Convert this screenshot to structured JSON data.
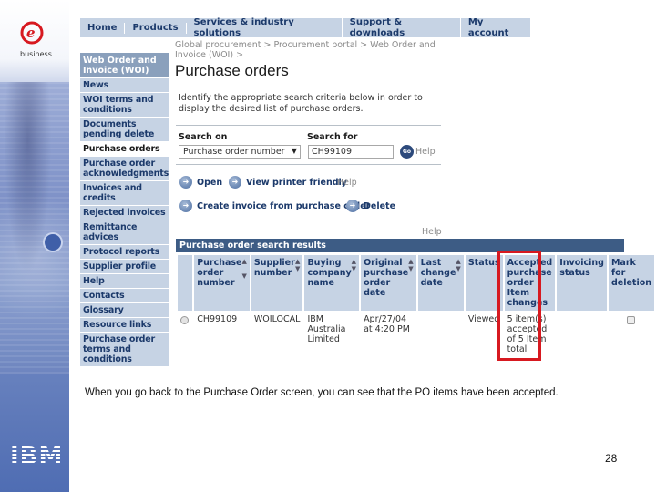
{
  "slide": {
    "caption": "When you go back to the Purchase Order screen, you can see that the PO items have been accepted.",
    "page_number": "28",
    "logo_top": {
      "icon": "e-business-logo",
      "text": "business"
    },
    "logo_bottom": {
      "icon": "ibm-logo",
      "text": "IBM"
    }
  },
  "topnav": {
    "items": [
      "Home",
      "Products",
      "Services & industry solutions",
      "Support & downloads",
      "My account"
    ]
  },
  "sidenav": {
    "header": "Web Order and Invoice (WOI)",
    "items": [
      {
        "label": "News"
      },
      {
        "label": "WOI terms and conditions"
      },
      {
        "label": "Documents pending delete"
      },
      {
        "label": "Purchase orders",
        "active": true
      },
      {
        "label": "Purchase order acknowledgments"
      },
      {
        "label": "Invoices and credits"
      },
      {
        "label": "Rejected invoices"
      },
      {
        "label": "Remittance advices"
      },
      {
        "label": "Protocol reports"
      },
      {
        "label": "Supplier profile"
      },
      {
        "label": "Help"
      },
      {
        "label": "Contacts"
      },
      {
        "label": "Glossary"
      },
      {
        "label": "Resource links"
      },
      {
        "label": "Purchase order terms and conditions"
      }
    ]
  },
  "page": {
    "breadcrumb": "Global procurement > Procurement portal > Web Order and Invoice (WOI) >",
    "title": "Purchase orders",
    "intro": "Identify the appropriate search criteria below in order to display the desired list of purchase orders."
  },
  "search": {
    "search_on_label": "Search on",
    "search_on_value": "Purchase order number",
    "search_for_label": "Search for",
    "search_for_value": "CH99109",
    "go_label": "Go",
    "help_label": "Help"
  },
  "actions": {
    "open": "Open",
    "printer": "View printer friendly",
    "help": "Help",
    "create_invoice": "Create invoice from purchase order",
    "delete": "Delete",
    "results_help": "Help"
  },
  "results": {
    "title": "Purchase order search results",
    "columns": [
      {
        "label": "Purchase order number",
        "sortable": true
      },
      {
        "label": "Supplier number",
        "sortable": true
      },
      {
        "label": "Buying company name",
        "sortable": true
      },
      {
        "label": "Original purchase order date",
        "sortable": true
      },
      {
        "label": "Last change date",
        "sortable": true
      },
      {
        "label": "Status",
        "sortable": false
      },
      {
        "label": "Accepted purchase order Item changes",
        "sortable": false
      },
      {
        "label": "Invoicing status",
        "sortable": false
      },
      {
        "label": "Mark for deletion",
        "sortable": false
      }
    ],
    "rows": [
      {
        "po_number": "CH99109",
        "supplier": "WOILOCAL",
        "buyer": "IBM Australia Limited",
        "original_date": "Apr/27/04 at 4:20 PM",
        "last_change": "",
        "status": "Viewed",
        "accepted_changes": "5 item(s) accepted of 5 Item total",
        "invoicing_status": "",
        "selected": false,
        "mark_for_deletion": false
      }
    ],
    "highlight_color": "#d71920"
  },
  "colors": {
    "nav_bg": "#c6d3e4",
    "nav_text": "#1c3a6b",
    "results_bar": "#3d5c85",
    "sidenav_header": "#8aa0bc"
  }
}
